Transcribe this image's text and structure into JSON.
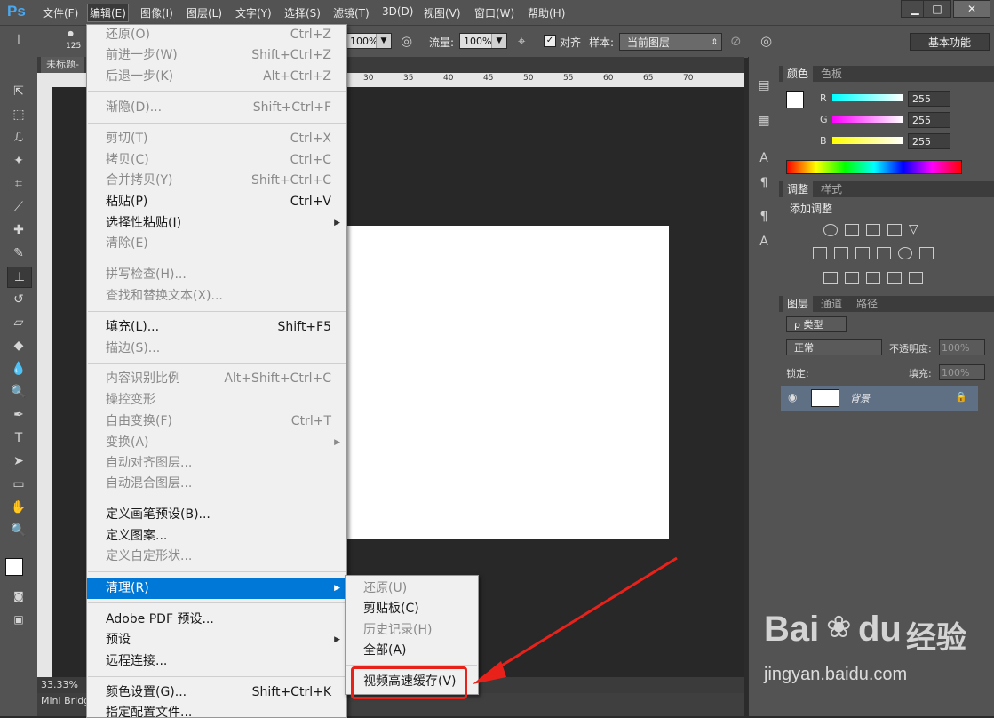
{
  "app": {
    "logo": "Ps"
  },
  "menubar": {
    "items": [
      "文件(F)",
      "编辑(E)",
      "图像(I)",
      "图层(L)",
      "文字(Y)",
      "选择(S)",
      "滤镜(T)",
      "3D(D)",
      "视图(V)",
      "窗口(W)",
      "帮助(H)"
    ],
    "active": "编辑(E)"
  },
  "window_controls": [
    "▁",
    "□",
    "✕"
  ],
  "options_bar": {
    "brush_size": "125",
    "opacity_value": "100%",
    "flow_label": "流量:",
    "flow_value": "100%",
    "align_label": "对齐",
    "sample_label": "样本:",
    "sample_value": "当前图层",
    "workspace": "基本功能"
  },
  "document": {
    "tab_title": "未标题-",
    "zoom": "33.33%",
    "bottom_tab": "Mini Bridge",
    "ruler_marks": [
      "30",
      "35",
      "40",
      "45",
      "50",
      "55",
      "60",
      "65",
      "70"
    ]
  },
  "edit_menu": {
    "items": [
      {
        "label": "还原(O)",
        "shortcut": "Ctrl+Z",
        "disabled": true
      },
      {
        "label": "前进一步(W)",
        "shortcut": "Shift+Ctrl+Z",
        "disabled": true
      },
      {
        "label": "后退一步(K)",
        "shortcut": "Alt+Ctrl+Z",
        "disabled": true
      },
      {
        "label": "渐隐(D)...",
        "shortcut": "Shift+Ctrl+F",
        "disabled": true
      },
      {
        "label": "剪切(T)",
        "shortcut": "Ctrl+X",
        "disabled": true
      },
      {
        "label": "拷贝(C)",
        "shortcut": "Ctrl+C",
        "disabled": true
      },
      {
        "label": "合并拷贝(Y)",
        "shortcut": "Shift+Ctrl+C",
        "disabled": true
      },
      {
        "label": "粘贴(P)",
        "shortcut": "Ctrl+V",
        "disabled": false
      },
      {
        "label": "选择性粘贴(I)",
        "shortcut": "",
        "disabled": false,
        "submenu": true
      },
      {
        "label": "清除(E)",
        "shortcut": "",
        "disabled": true
      },
      {
        "label": "拼写检查(H)...",
        "shortcut": "",
        "disabled": true
      },
      {
        "label": "查找和替换文本(X)...",
        "shortcut": "",
        "disabled": true
      },
      {
        "label": "填充(L)...",
        "shortcut": "Shift+F5",
        "disabled": false
      },
      {
        "label": "描边(S)...",
        "shortcut": "",
        "disabled": true
      },
      {
        "label": "内容识别比例",
        "shortcut": "Alt+Shift+Ctrl+C",
        "disabled": true
      },
      {
        "label": "操控变形",
        "shortcut": "",
        "disabled": true
      },
      {
        "label": "自由变换(F)",
        "shortcut": "Ctrl+T",
        "disabled": true
      },
      {
        "label": "变换(A)",
        "shortcut": "",
        "disabled": true,
        "submenu": true
      },
      {
        "label": "自动对齐图层...",
        "shortcut": "",
        "disabled": true
      },
      {
        "label": "自动混合图层...",
        "shortcut": "",
        "disabled": true
      },
      {
        "label": "定义画笔预设(B)...",
        "shortcut": "",
        "disabled": false
      },
      {
        "label": "定义图案...",
        "shortcut": "",
        "disabled": false
      },
      {
        "label": "定义自定形状...",
        "shortcut": "",
        "disabled": true
      },
      {
        "label": "清理(R)",
        "shortcut": "",
        "disabled": false,
        "submenu": true,
        "highlighted": true
      },
      {
        "label": "Adobe PDF 预设...",
        "shortcut": "",
        "disabled": false
      },
      {
        "label": "预设",
        "shortcut": "",
        "disabled": false,
        "submenu": true
      },
      {
        "label": "远程连接...",
        "shortcut": "",
        "disabled": false
      },
      {
        "label": "颜色设置(G)...",
        "shortcut": "Shift+Ctrl+K",
        "disabled": false
      },
      {
        "label": "指定配置文件...",
        "shortcut": "",
        "disabled": false
      }
    ]
  },
  "purge_submenu": {
    "items": [
      {
        "label": "还原(U)",
        "disabled": true
      },
      {
        "label": "剪贴板(C)",
        "disabled": false
      },
      {
        "label": "历史记录(H)",
        "disabled": true
      },
      {
        "label": "全部(A)",
        "disabled": false
      },
      {
        "label": "视频高速缓存(V)",
        "disabled": false
      }
    ]
  },
  "color_panel": {
    "tabs": [
      "颜色",
      "色板"
    ],
    "channels": [
      {
        "name": "R",
        "value": "255"
      },
      {
        "name": "G",
        "value": "255"
      },
      {
        "name": "B",
        "value": "255"
      }
    ]
  },
  "adjust_panel": {
    "tabs": [
      "调整",
      "样式"
    ],
    "title": "添加调整"
  },
  "layers_panel": {
    "tabs": [
      "图层",
      "通道",
      "路径"
    ],
    "filter_label": "ρ 类型",
    "blend_mode": "正常",
    "opacity_label": "不透明度:",
    "opacity_value": "100%",
    "lock_label": "锁定:",
    "fill_label": "填充:",
    "fill_value": "100%",
    "layer_name": "背景"
  },
  "watermark": {
    "brand_a": "Bai",
    "brand_b": "du",
    "brand_cn": "经验",
    "url": "jingyan.baidu.com"
  },
  "colors": {
    "accent": "#0078d7",
    "annotation": "#e8221b",
    "ui_bg": "#535353"
  }
}
